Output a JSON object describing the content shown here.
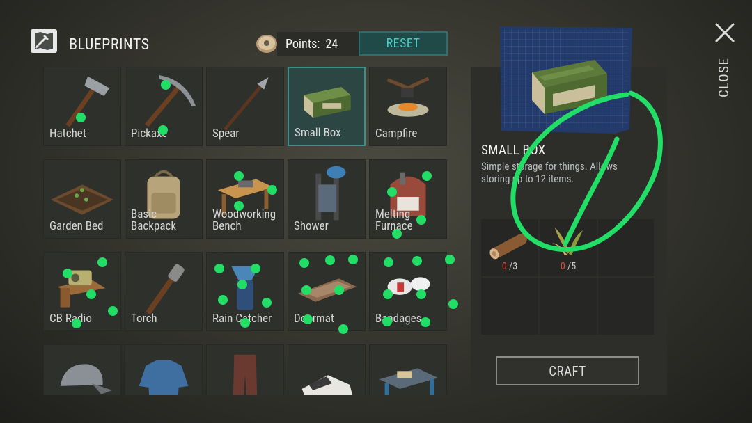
{
  "header": {
    "title": "BLUEPRINTS",
    "points_label": "Points:",
    "points_value": "24",
    "reset_label": "RESET",
    "close_label": "CLOSE"
  },
  "blueprints": [
    {
      "label": "Hatchet",
      "icon": "hatchet-icon"
    },
    {
      "label": "Pickaxe",
      "icon": "pickaxe-icon"
    },
    {
      "label": "Spear",
      "icon": "spear-icon"
    },
    {
      "label": "Small Box",
      "icon": "small-box-icon",
      "selected": true
    },
    {
      "label": "Campfire",
      "icon": "campfire-icon"
    },
    {
      "label": "Garden Bed",
      "icon": "garden-bed-icon"
    },
    {
      "label": "Basic\nBackpack",
      "icon": "backpack-icon"
    },
    {
      "label": "Woodworking\nBench",
      "icon": "woodworking-bench-icon"
    },
    {
      "label": "Shower",
      "icon": "shower-icon"
    },
    {
      "label": "Melting\nFurnace",
      "icon": "furnace-icon"
    },
    {
      "label": "CB Radio",
      "icon": "radio-icon"
    },
    {
      "label": "Torch",
      "icon": "torch-icon"
    },
    {
      "label": "Rain Catcher",
      "icon": "rain-catcher-icon"
    },
    {
      "label": "Doormat",
      "icon": "doormat-icon"
    },
    {
      "label": "Bandages",
      "icon": "bandages-icon"
    },
    {
      "label": "",
      "icon": "cap-icon"
    },
    {
      "label": "",
      "icon": "shirt-icon"
    },
    {
      "label": "",
      "icon": "pants-icon"
    },
    {
      "label": "",
      "icon": "sneakers-icon"
    },
    {
      "label": "",
      "icon": "workbench-icon"
    }
  ],
  "detail": {
    "name": "SMALL BOX",
    "description": "Simple storage for things. Allows storing up to 12 items.",
    "ingredients": [
      {
        "icon": "log-icon",
        "have": "0",
        "need": "/3"
      },
      {
        "icon": "plant-fiber-icon",
        "have": "0",
        "need": "/5"
      }
    ],
    "craft_label": "CRAFT"
  },
  "colors": {
    "accent_teal": "#3fd0c6",
    "selected_border": "#3f8f87",
    "missing_red": "#e04b3a",
    "annotation_green": "#22dd66"
  }
}
